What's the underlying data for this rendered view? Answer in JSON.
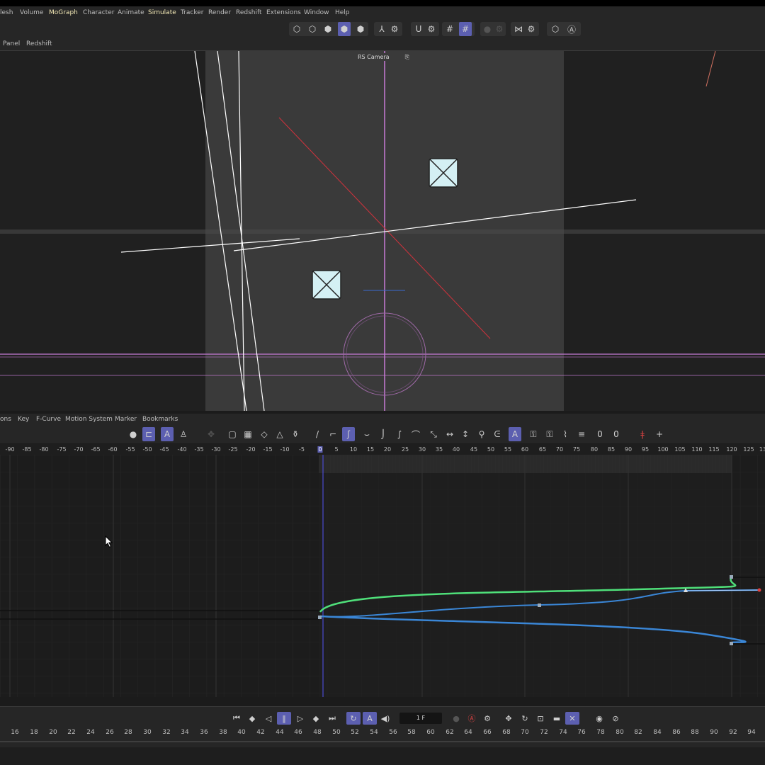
{
  "menubar": {
    "items": [
      "lesh",
      "Volume",
      "MoGraph",
      "Character",
      "Animate",
      "Simulate",
      "Tracker",
      "Render",
      "Redshift",
      "Extensions",
      "Window",
      "Help"
    ]
  },
  "toolbar": {
    "icons": [
      "cube-icon",
      "cone-icon",
      "sphere-icon",
      "camera-icon",
      "light-icon",
      "spline-icon",
      "gear-icon",
      "magnet-icon",
      "settings-icon",
      "grid-icon",
      "snap-grid-icon",
      "record-icon",
      "gear-icon",
      "mirror-icon",
      "gear-icon",
      "hex-icon",
      "a-icon"
    ]
  },
  "viewport_menu": {
    "items": [
      "Panel",
      "Redshift"
    ]
  },
  "viewport": {
    "camera_label": "RS Camera"
  },
  "timeline_menu": {
    "items": [
      "ons",
      "Key",
      "F-Curve",
      "Motion System",
      "Marker",
      "Bookmarks"
    ]
  },
  "ruler": {
    "ticks": [
      "-90",
      "-85",
      "-80",
      "-75",
      "-70",
      "-65",
      "-60",
      "-55",
      "-50",
      "-45",
      "-40",
      "-35",
      "-30",
      "-25",
      "-20",
      "-15",
      "-10",
      "-5",
      "0",
      "5",
      "10",
      "15",
      "20",
      "25",
      "30",
      "35",
      "40",
      "45",
      "50",
      "55",
      "60",
      "65",
      "70",
      "75",
      "80",
      "85",
      "90",
      "95",
      "100",
      "105",
      "110",
      "115",
      "120",
      "125",
      "13"
    ]
  },
  "transport": {
    "frame_value": "1 F"
  },
  "bottom_ruler": {
    "ticks": [
      "16",
      "18",
      "20",
      "22",
      "24",
      "26",
      "28",
      "30",
      "32",
      "34",
      "36",
      "38",
      "40",
      "42",
      "44",
      "46",
      "48",
      "50",
      "52",
      "54",
      "56",
      "58",
      "60",
      "62",
      "64",
      "66",
      "68",
      "70",
      "72",
      "74",
      "76",
      "78",
      "80",
      "82",
      "84",
      "86",
      "88",
      "90",
      "92",
      "94"
    ]
  },
  "colors": {
    "accent": "#5c5fb0",
    "curve_green": "#4fe07a",
    "curve_blue": "#3a86d6",
    "axis_red": "#d0323c",
    "guide_magenta": "#c77bd6"
  }
}
